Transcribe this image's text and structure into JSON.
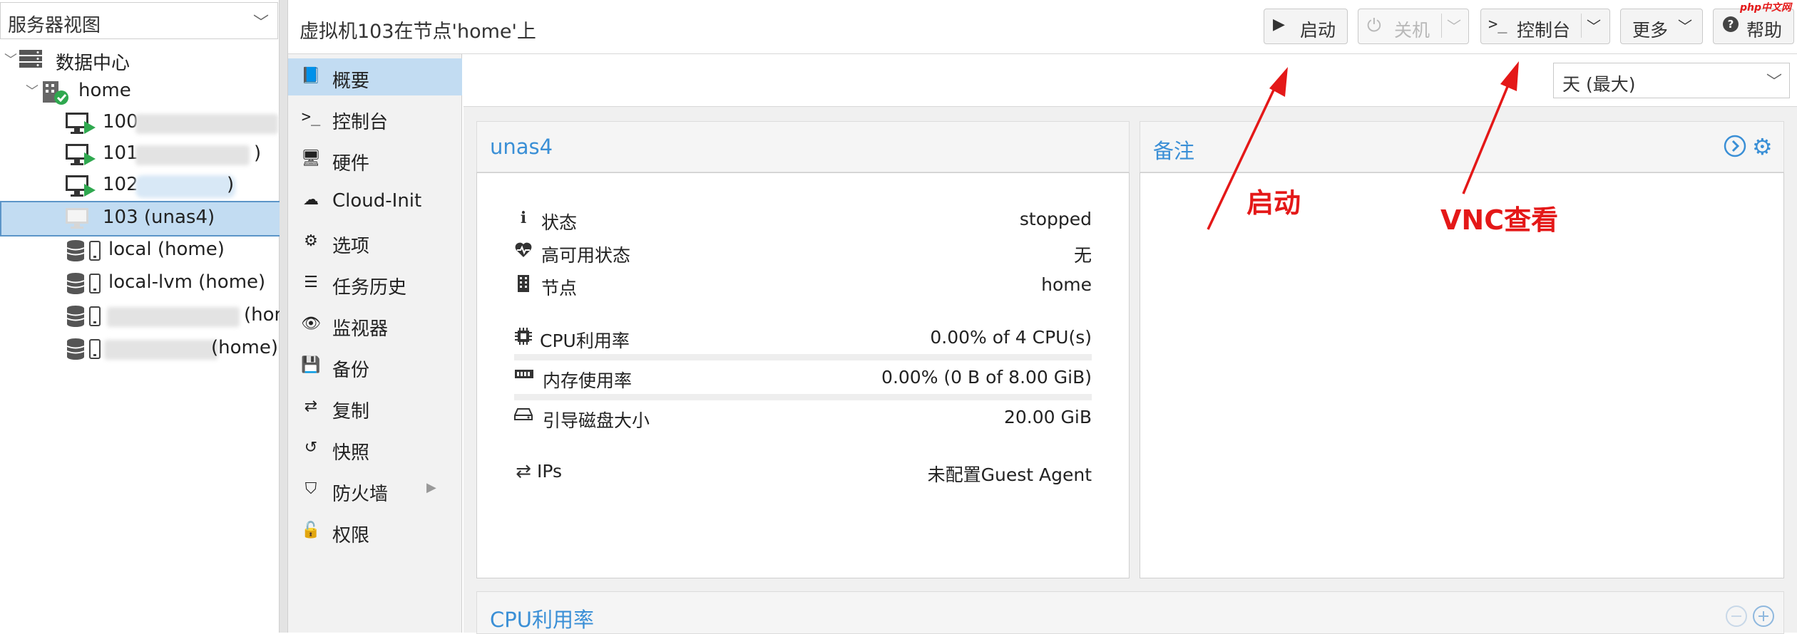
{
  "tree": {
    "view_label": "服务器视图",
    "datacenter": "数据中心",
    "node": "home",
    "vms": [
      {
        "id": "100",
        "tail": ")"
      },
      {
        "id": "101",
        "tail": ")"
      },
      {
        "id": "102",
        "tail": ")"
      },
      {
        "id": "103 (unas4)"
      }
    ],
    "storage": [
      {
        "label": "local (home)"
      },
      {
        "label": "local-lvm (home)"
      },
      {
        "label": "(hom"
      },
      {
        "label": "(home)"
      }
    ]
  },
  "header": {
    "title": "虚拟机103在节点'home'上",
    "start": "启动",
    "shutdown": "关机",
    "console": "控制台",
    "more": "更多",
    "help": "帮助"
  },
  "nav": {
    "items": [
      {
        "label": "概要",
        "icon": "book-icon"
      },
      {
        "label": "控制台",
        "icon": "terminal-icon"
      },
      {
        "label": "硬件",
        "icon": "monitor-icon"
      },
      {
        "label": "Cloud-Init",
        "icon": "cloud-icon"
      },
      {
        "label": "选项",
        "icon": "gear-icon"
      },
      {
        "label": "任务历史",
        "icon": "list-icon"
      },
      {
        "label": "监视器",
        "icon": "eye-icon"
      },
      {
        "label": "备份",
        "icon": "floppy-icon"
      },
      {
        "label": "复制",
        "icon": "retweet-icon"
      },
      {
        "label": "快照",
        "icon": "history-icon"
      },
      {
        "label": "防火墙",
        "icon": "shield-icon"
      },
      {
        "label": "权限",
        "icon": "unlock-icon"
      }
    ]
  },
  "range": {
    "selected": "天 (最大)"
  },
  "summary": {
    "title": "unas4",
    "status_label": "状态",
    "status_value": "stopped",
    "ha_label": "高可用状态",
    "ha_value": "无",
    "node_label": "节点",
    "node_value": "home",
    "cpu_label": "CPU利用率",
    "cpu_value": "0.00% of 4 CPU(s)",
    "cpu_fraction": 0.0,
    "mem_label": "内存使用率",
    "mem_value": "0.00% (0 B of 8.00 GiB)",
    "mem_fraction": 0.0,
    "disk_label": "引导磁盘大小",
    "disk_value": "20.00 GiB",
    "ips_label": "IPs",
    "ips_value": "未配置Guest Agent"
  },
  "notes": {
    "title": "备注"
  },
  "cpu_panel": {
    "title": "CPU利用率"
  },
  "annotations": {
    "start": "启动",
    "vnc": "VNC查看"
  },
  "watermark": "php中文网",
  "colors": {
    "accent": "#3a8fd6",
    "selection": "#c2dcf2",
    "annotation": "#e41818",
    "running": "#2fa84f"
  }
}
